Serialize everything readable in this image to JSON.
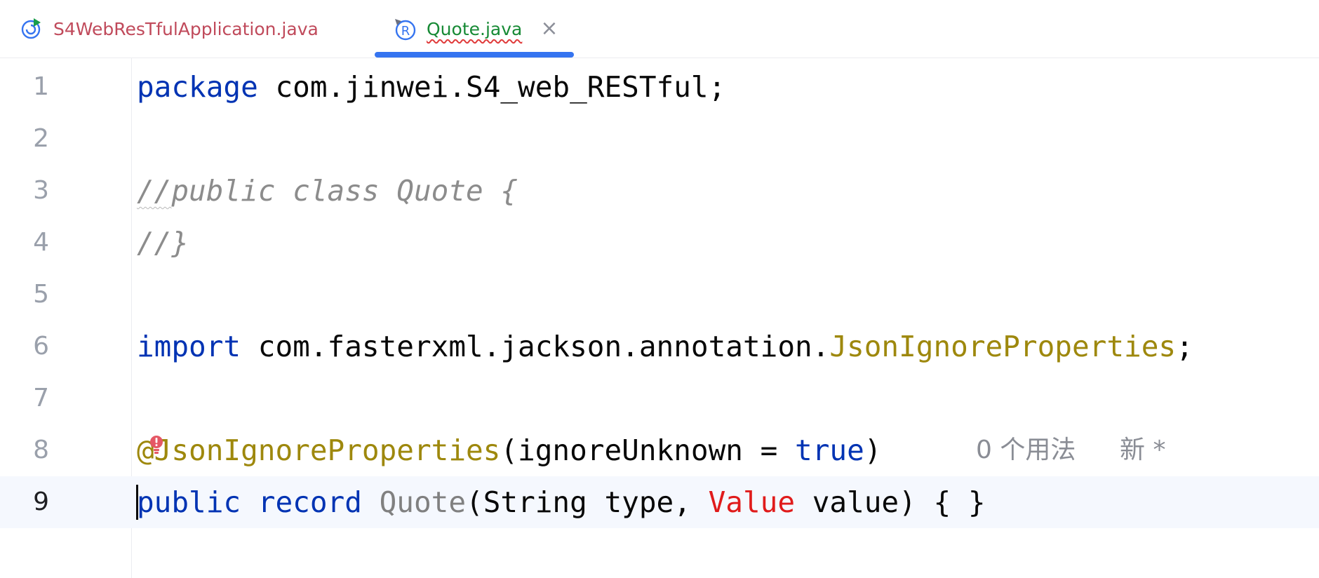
{
  "tabs": [
    {
      "label": "S4WebResTfulApplication.java",
      "icon": "spring-boot-app-icon",
      "active": false
    },
    {
      "label": "Quote.java",
      "icon": "record-icon",
      "active": true,
      "close": "×"
    }
  ],
  "colors": {
    "keyword": "#0033b3",
    "comment": "#8c8c8c",
    "annotation": "#9e880d",
    "error": "#e01b1b",
    "unused": "#808080",
    "active_tab_indicator": "#3574f0",
    "current_line": "#f5f8fe"
  },
  "editor": {
    "current_line": 9,
    "lines": [
      {
        "number": "1",
        "tokens": [
          "package",
          " com.jinwei.S4_web_RESTful;"
        ]
      },
      {
        "number": "2",
        "tokens": []
      },
      {
        "number": "3",
        "tokens": [
          "//",
          "public class Quote {"
        ]
      },
      {
        "number": "4",
        "tokens": [
          "//}"
        ]
      },
      {
        "number": "5",
        "tokens": []
      },
      {
        "number": "6",
        "tokens": [
          "import",
          " com.fasterxml.jackson.annotation.",
          "JsonIgnoreProperties",
          ";"
        ]
      },
      {
        "number": "7",
        "tokens": []
      },
      {
        "number": "8",
        "tokens": [
          "@JsonIgnoreProperties",
          "(ignoreUnknown = ",
          "true",
          ")"
        ]
      },
      {
        "number": "9",
        "tokens": [
          "public",
          " ",
          "record",
          " ",
          "Quote",
          "(String type, ",
          "Value",
          " value) { }"
        ]
      }
    ],
    "inlay_hints": {
      "usages": "0 个用法",
      "author": "新 *"
    },
    "intention_icon": "error-bulb-icon"
  }
}
